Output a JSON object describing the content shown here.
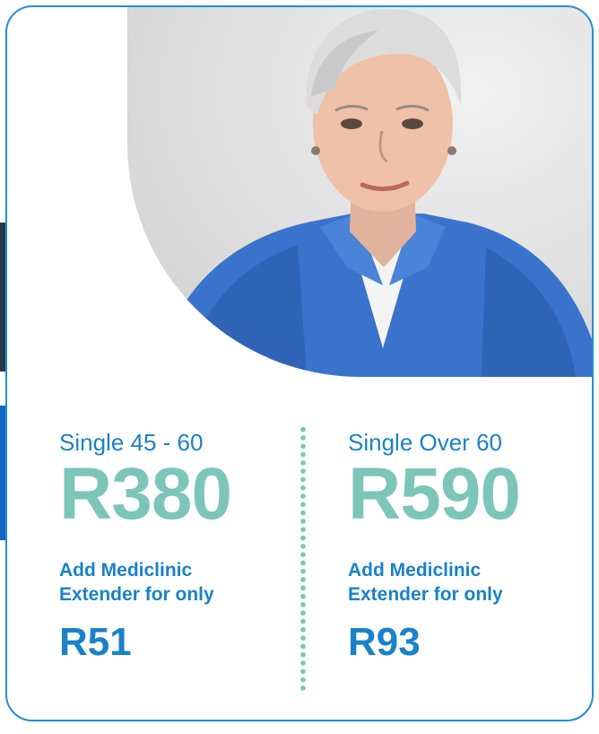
{
  "left_plan": {
    "label": "Single 45 - 60",
    "price": "R380",
    "extender_line1": "Add Mediclinic",
    "extender_line2": "Extender for only",
    "extender_price": "R51"
  },
  "right_plan": {
    "label": "Single Over 60",
    "price": "R590",
    "extender_line1": "Add Mediclinic",
    "extender_line2": "Extender for only",
    "extender_price": "R93"
  },
  "colors": {
    "border": "#1f8fd6",
    "blue_text": "#1a82c9",
    "teal_price": "#7cc6b8",
    "divider_dots": "#7cc6b8"
  }
}
